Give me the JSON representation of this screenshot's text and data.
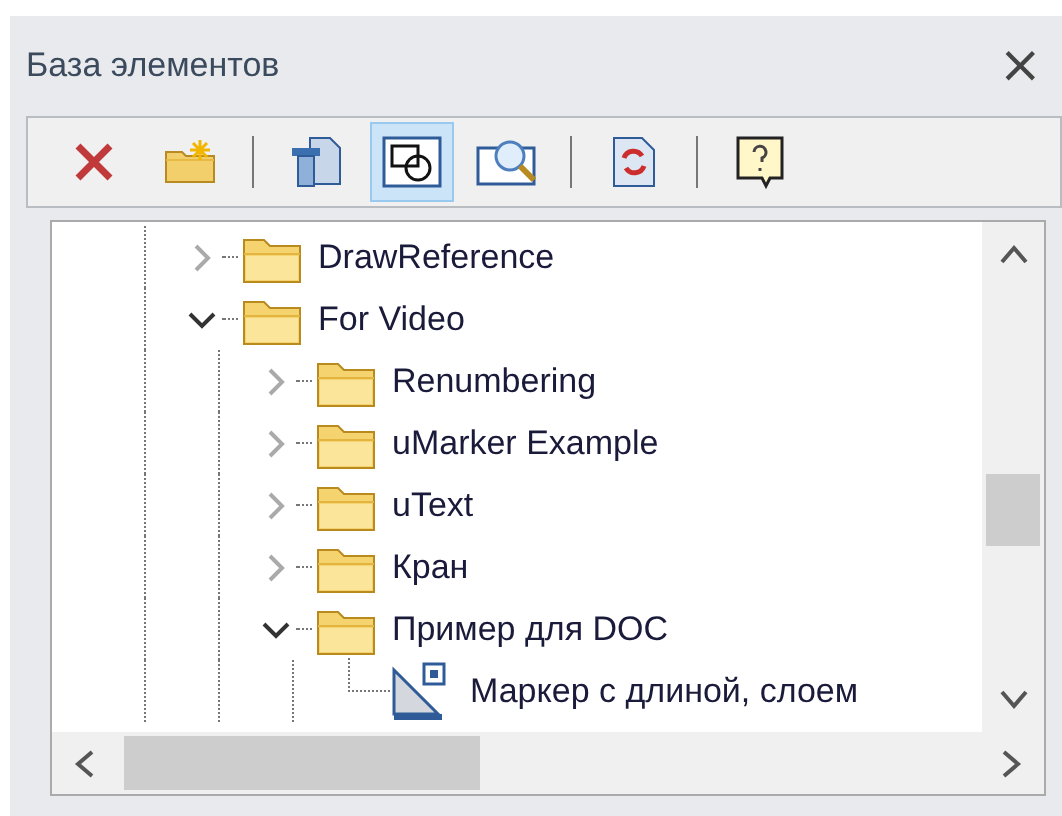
{
  "panel": {
    "title": "База элементов",
    "close": "×"
  },
  "toolbar": [
    [
      {
        "kind": "delete",
        "selected": false
      },
      {
        "kind": "new-folder",
        "selected": false
      }
    ],
    [
      {
        "kind": "copy",
        "selected": false
      },
      {
        "kind": "shapes",
        "selected": true
      },
      {
        "kind": "preview",
        "selected": false
      }
    ],
    [
      {
        "kind": "refresh",
        "selected": false
      }
    ],
    [
      {
        "kind": "help",
        "selected": false
      }
    ]
  ],
  "tree": [
    {
      "label": "DrawReference",
      "kind": "folder",
      "expanded": false
    },
    {
      "label": "For Video",
      "kind": "folder",
      "expanded": true,
      "children": [
        {
          "label": "Renumbering",
          "kind": "folder",
          "expanded": false
        },
        {
          "label": "uMarker Example",
          "kind": "folder",
          "expanded": false
        },
        {
          "label": "uText",
          "kind": "folder",
          "expanded": false
        },
        {
          "label": "Кран",
          "kind": "folder",
          "expanded": false
        },
        {
          "label": "Пример для DOC",
          "kind": "folder",
          "expanded": true,
          "children": [
            {
              "label": "Маркер с длиной, слоем",
              "kind": "marker"
            }
          ]
        }
      ]
    }
  ]
}
